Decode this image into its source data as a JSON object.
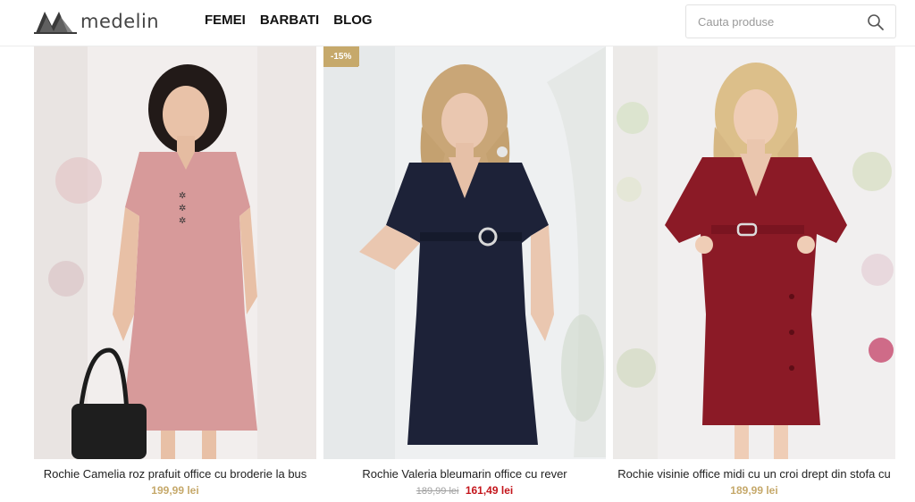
{
  "brand": {
    "name": "medelin"
  },
  "nav": [
    {
      "label": "FEMEI"
    },
    {
      "label": "BARBATI"
    },
    {
      "label": "BLOG"
    }
  ],
  "search": {
    "placeholder": "Cauta produse",
    "icon": "search-icon"
  },
  "products": [
    {
      "title": "Rochie Camelia roz prafuit office cu broderie la bus",
      "price": "199,99 lei",
      "dress_color": "#d79a9a",
      "background": "#f2eeed"
    },
    {
      "title": "Rochie Valeria bleumarin office cu rever",
      "badge": "-15%",
      "old_price": "189,99 lei",
      "price": "161,49 lei",
      "dress_color": "#1d2238",
      "background": "#eef0f1"
    },
    {
      "title": "Rochie visinie office midi cu un croi drept din stofa cu",
      "price": "189,99 lei",
      "dress_color": "#8b1a26",
      "background": "#f1efef"
    }
  ],
  "colors": {
    "accent_gold": "#c6a96b",
    "sale_red": "#c4161c"
  }
}
